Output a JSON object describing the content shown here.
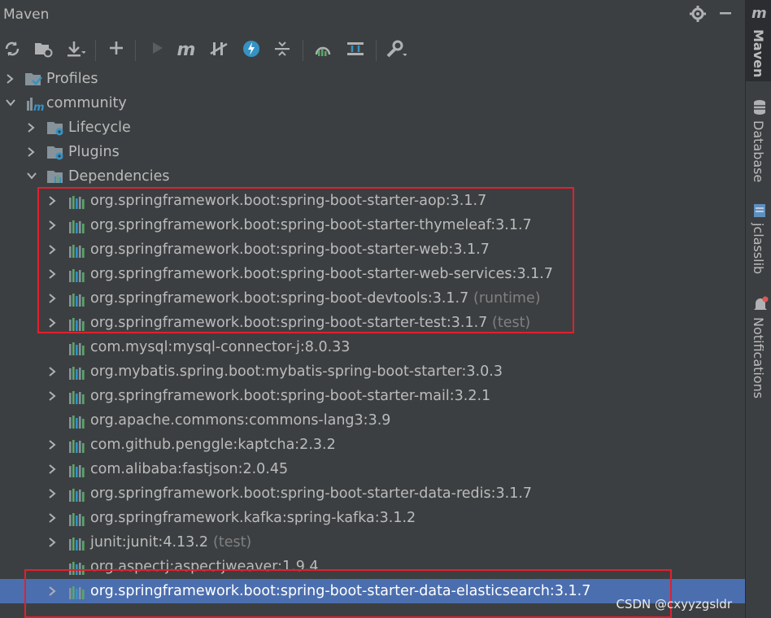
{
  "header": {
    "title": "Maven"
  },
  "sidebar": {
    "maven_label": "Maven",
    "database_label": "Database",
    "jclasslib_label": "jclasslib",
    "notifications_label": "Notifications"
  },
  "tree": {
    "profiles": "Profiles",
    "project": "community",
    "lifecycle": "Lifecycle",
    "plugins": "Plugins",
    "dependencies": "Dependencies",
    "deps": [
      {
        "name": "org.springframework.boot:spring-boot-starter-aop:3.1.7",
        "scope": ""
      },
      {
        "name": "org.springframework.boot:spring-boot-starter-thymeleaf:3.1.7",
        "scope": ""
      },
      {
        "name": "org.springframework.boot:spring-boot-starter-web:3.1.7",
        "scope": ""
      },
      {
        "name": "org.springframework.boot:spring-boot-starter-web-services:3.1.7",
        "scope": ""
      },
      {
        "name": "org.springframework.boot:spring-boot-devtools:3.1.7",
        "scope": "(runtime)"
      },
      {
        "name": "org.springframework.boot:spring-boot-starter-test:3.1.7",
        "scope": "(test)"
      },
      {
        "name": "com.mysql:mysql-connector-j:8.0.33",
        "scope": ""
      },
      {
        "name": "org.mybatis.spring.boot:mybatis-spring-boot-starter:3.0.3",
        "scope": ""
      },
      {
        "name": "org.springframework.boot:spring-boot-starter-mail:3.2.1",
        "scope": ""
      },
      {
        "name": "org.apache.commons:commons-lang3:3.9",
        "scope": ""
      },
      {
        "name": "com.github.penggle:kaptcha:2.3.2",
        "scope": ""
      },
      {
        "name": "com.alibaba:fastjson:2.0.45",
        "scope": ""
      },
      {
        "name": "org.springframework.boot:spring-boot-starter-data-redis:3.1.7",
        "scope": ""
      },
      {
        "name": "org.springframework.kafka:spring-kafka:3.1.2",
        "scope": ""
      },
      {
        "name": "junit:junit:4.13.2",
        "scope": "(test)"
      },
      {
        "name": "org.aspectj:aspectjweaver:1.9.4",
        "scope": ""
      },
      {
        "name": "org.springframework.boot:spring-boot-starter-data-elasticsearch:3.1.7",
        "scope": ""
      }
    ]
  },
  "watermark": "CSDN @cxyyzgsldr",
  "colors": {
    "background": "#3c3f41",
    "selection": "#4b6eaf",
    "highlight_box": "#e2202e"
  }
}
